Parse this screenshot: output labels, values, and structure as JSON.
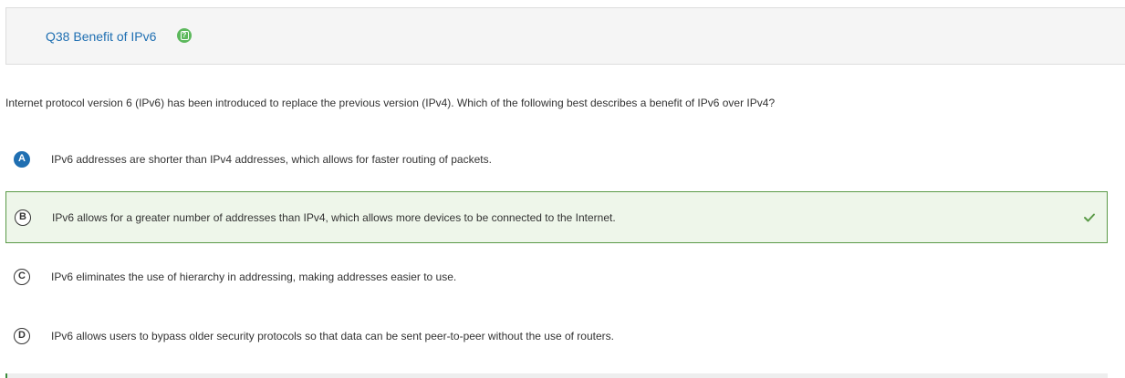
{
  "header": {
    "title": "Q38 Benefit of IPv6",
    "help_icon": "question-mark-icon"
  },
  "question": {
    "prompt": "Internet protocol version 6 (IPv6) has been introduced to replace the previous version (IPv4). Which of the following best describes a benefit of IPv6 over IPv4?"
  },
  "answers": [
    {
      "letter": "A",
      "text": "IPv6 addresses are shorter than IPv4 addresses, which allows for faster routing of packets.",
      "selected": true,
      "correct": false
    },
    {
      "letter": "B",
      "text": "IPv6 allows for a greater number of addresses than IPv4, which allows more devices to be connected to the Internet.",
      "selected": false,
      "correct": true
    },
    {
      "letter": "C",
      "text": "IPv6 eliminates the use of hierarchy in addressing, making addresses easier to use.",
      "selected": false,
      "correct": false
    },
    {
      "letter": "D",
      "text": "IPv6 allows users to bypass older security protocols so that data can be sent peer-to-peer without the use of routers.",
      "selected": false,
      "correct": false
    }
  ],
  "colors": {
    "title": "#1f6fb2",
    "help_icon": "#5cb85c",
    "selected_letter": "#1f6fb2",
    "correct_border": "#5a9a47",
    "correct_background": "#eef6ea",
    "checkmark": "#5a9a47"
  },
  "icons": {
    "correct_marker": "checkmark-icon"
  }
}
